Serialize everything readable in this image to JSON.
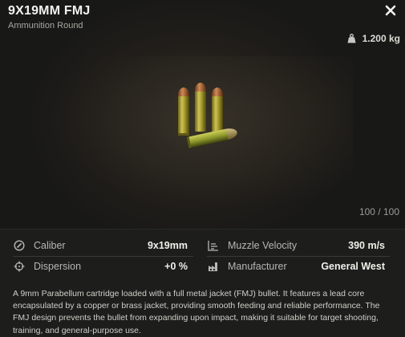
{
  "item": {
    "title": "9X19MM FMJ",
    "type": "Ammunition Round",
    "weight": "1.200 kg",
    "durability": "100 / 100"
  },
  "stats": {
    "caliber": {
      "label": "Caliber",
      "value": "9x19mm"
    },
    "dispersion": {
      "label": "Dispersion",
      "value": "+0 %"
    },
    "muzzle_velocity": {
      "label": "Muzzle Velocity",
      "value": "390 m/s"
    },
    "manufacturer": {
      "label": "Manufacturer",
      "value": "General West"
    }
  },
  "description": "A 9mm Parabellum cartridge loaded with a full metal jacket (FMJ) bullet. It features a lead core encapsulated by a copper or brass jacket, providing smooth feeding and reliable performance. The FMJ design prevents the bullet from expanding upon impact, making it suitable for target shooting, training, and general-purpose use.",
  "icons": {
    "close": "close-icon",
    "weight": "weight-icon",
    "caliber": "caliber-icon",
    "dispersion": "crosshair-icon",
    "muzzle_velocity": "velocity-icon",
    "manufacturer": "factory-icon"
  }
}
